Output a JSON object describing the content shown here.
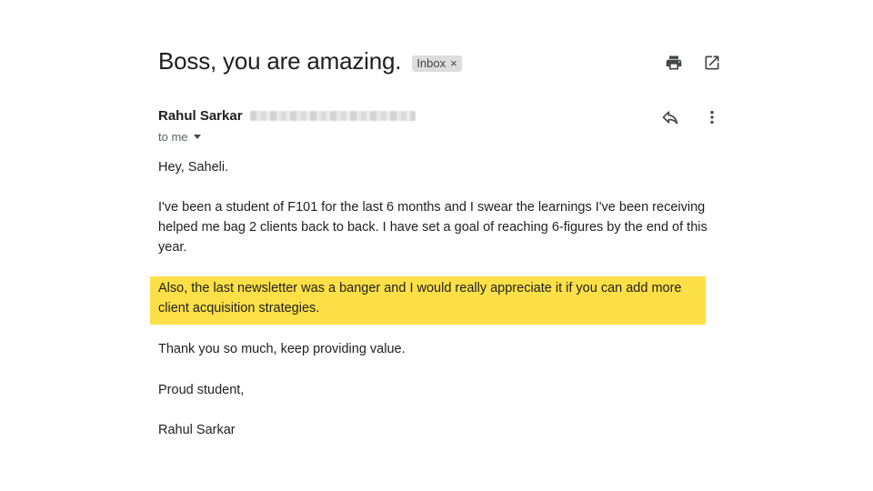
{
  "email": {
    "subject": "Boss, you are amazing.",
    "label": "Inbox",
    "label_remove": "×",
    "sender_name": "Rahul Sarkar",
    "recipient": "to me",
    "body": {
      "greeting": "Hey, Saheli.",
      "paragraph1_line1": "I've been a student of F101 for the last 6 months and I swear the learnings I've been receiving",
      "paragraph1_line2": "helped me bag 2 clients back to back. I have set a goal of reaching 6-figures by the end of this",
      "paragraph1_line3": "year.",
      "highlight_line1": "Also, the last newsletter was a banger and I would really appreciate it if you can add more",
      "highlight_line2": "client acquisition strategies.",
      "thanks": "Thank you so much, keep providing value.",
      "signoff": "Proud student,",
      "signature": "Rahul Sarkar"
    }
  },
  "icons": {
    "print": "print-icon",
    "open_new_window": "open-in-new-window-icon",
    "reply": "reply-icon",
    "more": "more-vertical-icon"
  },
  "colors": {
    "highlight": "#fde047",
    "chip_bg": "#dddddd",
    "secondary_text": "#5f6368"
  }
}
